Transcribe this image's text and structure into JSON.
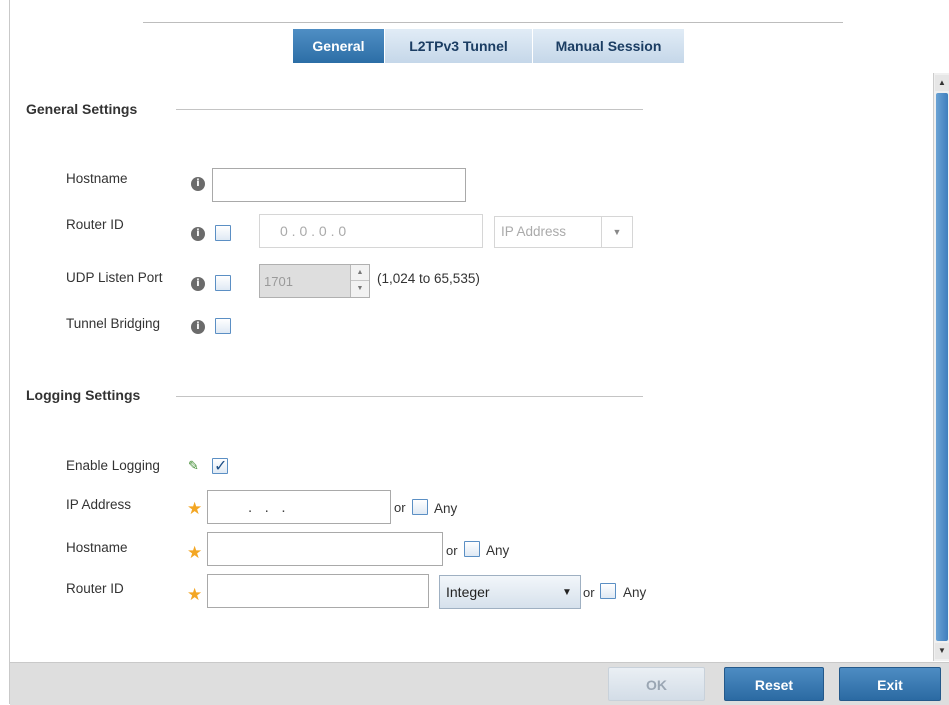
{
  "tabs": [
    {
      "label": "General",
      "active": true
    },
    {
      "label": "L2TPv3 Tunnel",
      "active": false
    },
    {
      "label": "Manual Session",
      "active": false
    }
  ],
  "general_settings": {
    "title": "General Settings",
    "hostname": {
      "label": "Hostname",
      "value": ""
    },
    "router_id": {
      "label": "Router ID",
      "checked": false,
      "ip_value": "0 . 0 . 0 . 0",
      "type_value": "IP Address"
    },
    "udp_listen_port": {
      "label": "UDP Listen Port",
      "checked": false,
      "value": "1701",
      "range": "(1,024 to 65,535)"
    },
    "tunnel_bridging": {
      "label": "Tunnel Bridging",
      "checked": false
    }
  },
  "logging_settings": {
    "title": "Logging Settings",
    "enable_logging": {
      "label": "Enable Logging",
      "checked": true
    },
    "ip_address": {
      "label": "IP Address",
      "value": ".   .   .",
      "or": "or",
      "any": "Any"
    },
    "hostname": {
      "label": "Hostname",
      "value": "",
      "or": "or",
      "any": "Any"
    },
    "router_id": {
      "label": "Router ID",
      "value": "",
      "type_value": "Integer",
      "or": "or",
      "any": "Any"
    }
  },
  "icons": {
    "info": "info-icon",
    "required": "asterisk-icon",
    "edit": "pencil-icon",
    "dropdown": "chevron-down-icon"
  },
  "footer": {
    "ok": "OK",
    "reset": "Reset",
    "exit": "Exit"
  },
  "colors": {
    "accent": "#2f70a9",
    "tab_inactive": "#d2e1ef",
    "required_star": "#f3a623"
  }
}
